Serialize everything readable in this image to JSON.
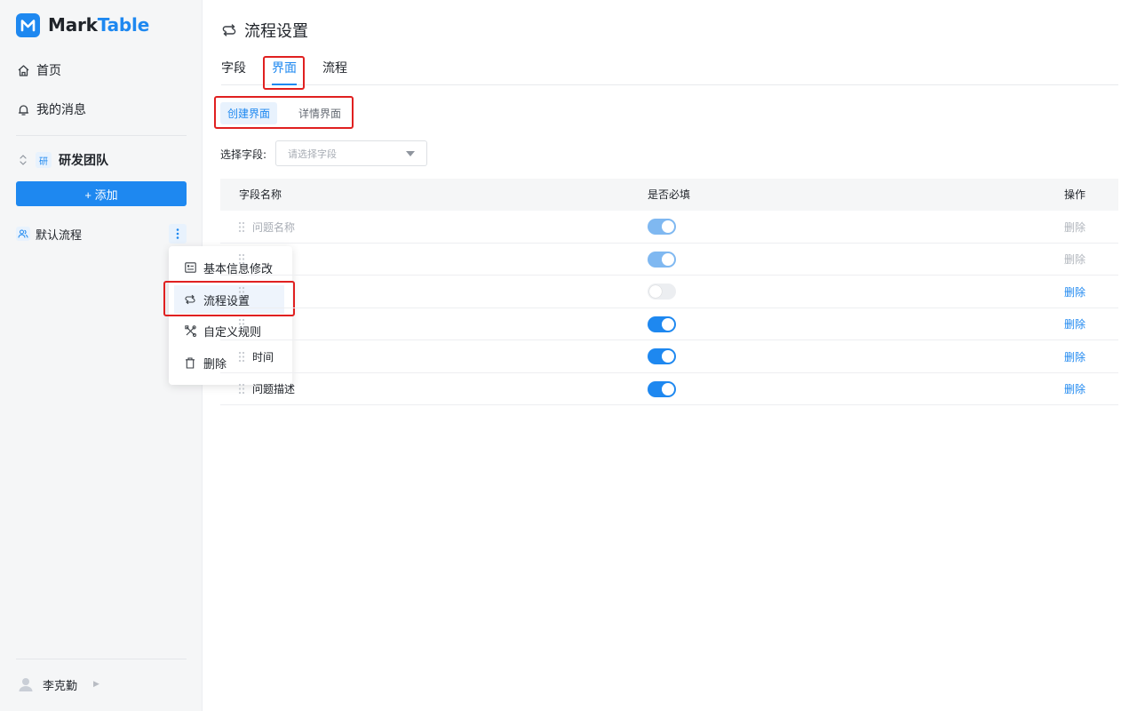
{
  "app": {
    "logo_prefix": "Mark",
    "logo_suffix": "Table"
  },
  "sidebar": {
    "nav": [
      {
        "label": "首页",
        "icon": "home-icon"
      },
      {
        "label": "我的消息",
        "icon": "bell-icon"
      }
    ],
    "team": {
      "badge": "研",
      "name": "研发团队"
    },
    "add_button": "+ 添加",
    "flow_item": "默认流程",
    "user_name": "李克勤"
  },
  "context_menu": {
    "items": [
      {
        "label": "基本信息修改",
        "icon": "form-icon"
      },
      {
        "label": "流程设置",
        "icon": "flow-swap-icon"
      },
      {
        "label": "自定义规则",
        "icon": "tools-icon"
      },
      {
        "label": "删除",
        "icon": "trash-icon"
      }
    ],
    "active_index": 1
  },
  "main": {
    "title": "流程设置",
    "tabs": [
      "字段",
      "界面",
      "流程"
    ],
    "active_tab": 1,
    "subtabs": [
      "创建界面",
      "详情界面"
    ],
    "active_subtab": 0,
    "field_select": {
      "label": "选择字段:",
      "placeholder": "请选择字段"
    },
    "table": {
      "headers": {
        "name": "字段名称",
        "required": "是否必填",
        "action": "操作"
      },
      "rows": [
        {
          "name": "问题名称",
          "required": true,
          "disabled": true,
          "action": "删除"
        },
        {
          "name": "",
          "required": true,
          "disabled": true,
          "action": "删除"
        },
        {
          "name": "",
          "required": false,
          "disabled": false,
          "action": "删除"
        },
        {
          "name": "",
          "required": true,
          "disabled": false,
          "action": "删除"
        },
        {
          "name": "时间",
          "required": true,
          "disabled": false,
          "action": "删除"
        },
        {
          "name": "问题描述",
          "required": true,
          "disabled": false,
          "action": "删除"
        }
      ]
    }
  },
  "colors": {
    "accent": "#1e88f0",
    "highlight": "#e02020",
    "sidebar_bg": "#f5f6f7"
  }
}
